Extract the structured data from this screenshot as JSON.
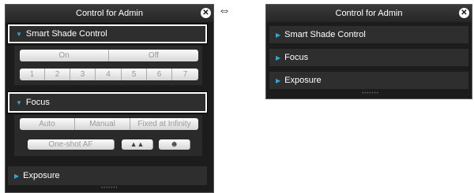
{
  "left_panel": {
    "title": "Control for Admin",
    "close_icon": "close-icon",
    "sections": {
      "smart_shade": {
        "label": "Smart Shade Control",
        "on_label": "On",
        "off_label": "Off",
        "levels": [
          "1",
          "2",
          "3",
          "4",
          "5",
          "6",
          "7"
        ]
      },
      "focus": {
        "label": "Focus",
        "modes": [
          "Auto",
          "Manual",
          "Fixed at Infinity"
        ],
        "oneshot_label": "One-shot AF",
        "near_icon": "mountain-icon",
        "far_icon": "person-icon"
      },
      "exposure": {
        "label": "Exposure"
      }
    }
  },
  "swap_symbol": "⇔",
  "right_panel": {
    "title": "Control for Admin",
    "sections": [
      "Smart Shade Control",
      "Focus",
      "Exposure"
    ]
  },
  "colors": {
    "accent": "#29a8e0",
    "panel_bg": "#1c1c1c",
    "section_bg": "#2e2e2e"
  }
}
